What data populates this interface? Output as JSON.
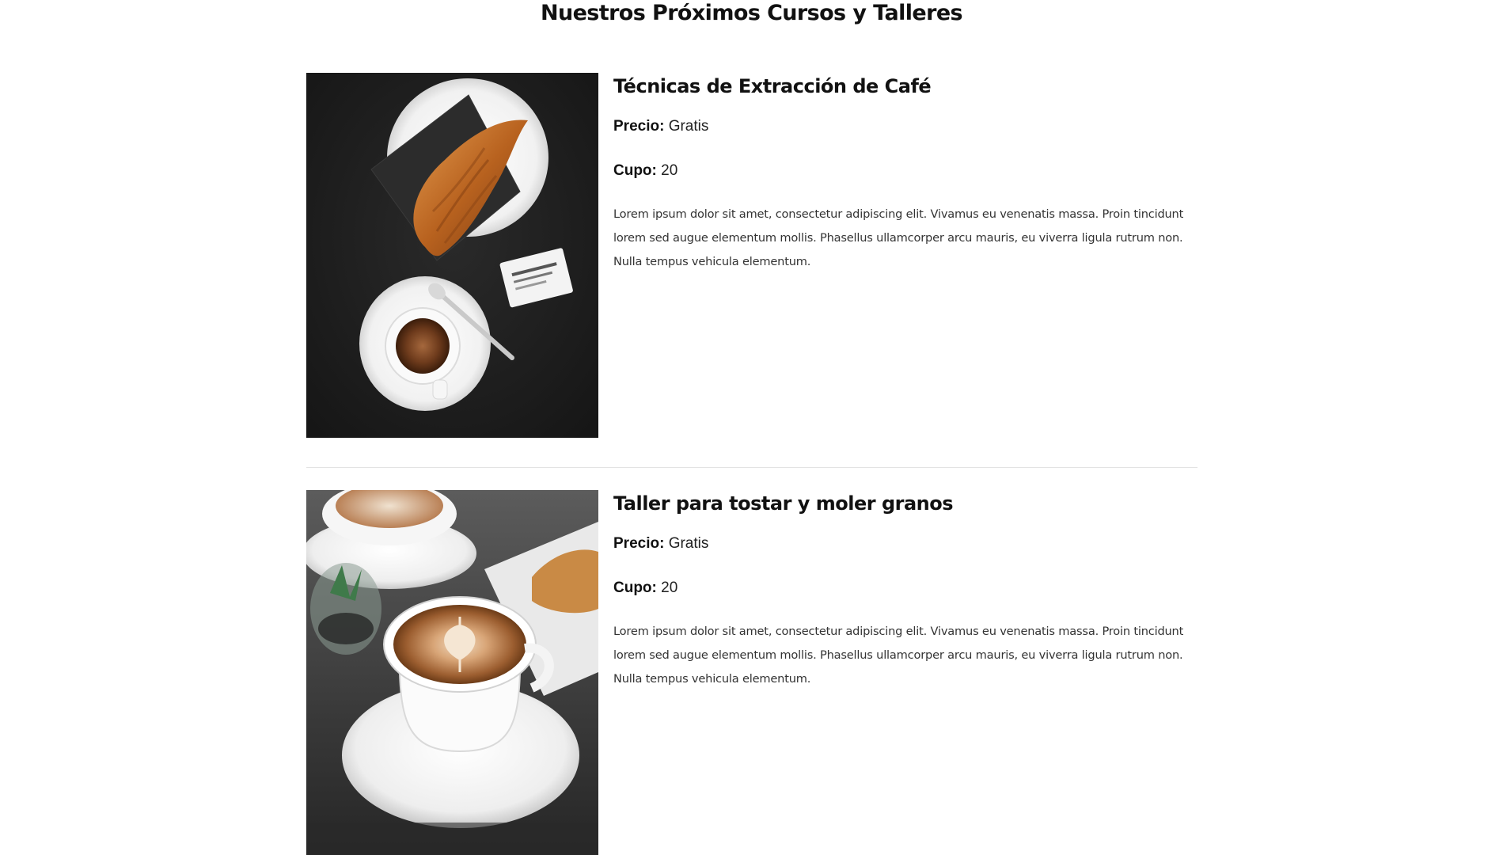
{
  "page": {
    "title": "Nuestros Próximos Cursos y Talleres"
  },
  "courses": [
    {
      "title": "Técnicas de Extracción de Café",
      "price_label": "Precio:",
      "price_value": "Gratis",
      "cupo_label": "Cupo:",
      "cupo_value": "20",
      "description": "Lorem ipsum dolor sit amet, consectetur adipiscing elit. Vivamus eu venenatis massa. Proin tincidunt lorem sed augue elementum mollis. Phasellus ullamcorper arcu mauris, eu viverra ligula rutrum non. Nulla tempus vehicula elementum.",
      "image": "croissant-and-espresso-photo"
    },
    {
      "title": "Taller para tostar y moler granos",
      "price_label": "Precio:",
      "price_value": "Gratis",
      "cupo_label": "Cupo:",
      "cupo_value": "20",
      "description": "Lorem ipsum dolor sit amet, consectetur adipiscing elit. Vivamus eu venenatis massa. Proin tincidunt lorem sed augue elementum mollis. Phasellus ullamcorper arcu mauris, eu viverra ligula rutrum non. Nulla tempus vehicula elementum.",
      "image": "latte-art-cappuccino-photo"
    }
  ],
  "colors": {
    "text": "#111111",
    "body_text": "#333333",
    "divider": "#e3e3e3",
    "photo_dark": "#1e1e1e"
  }
}
